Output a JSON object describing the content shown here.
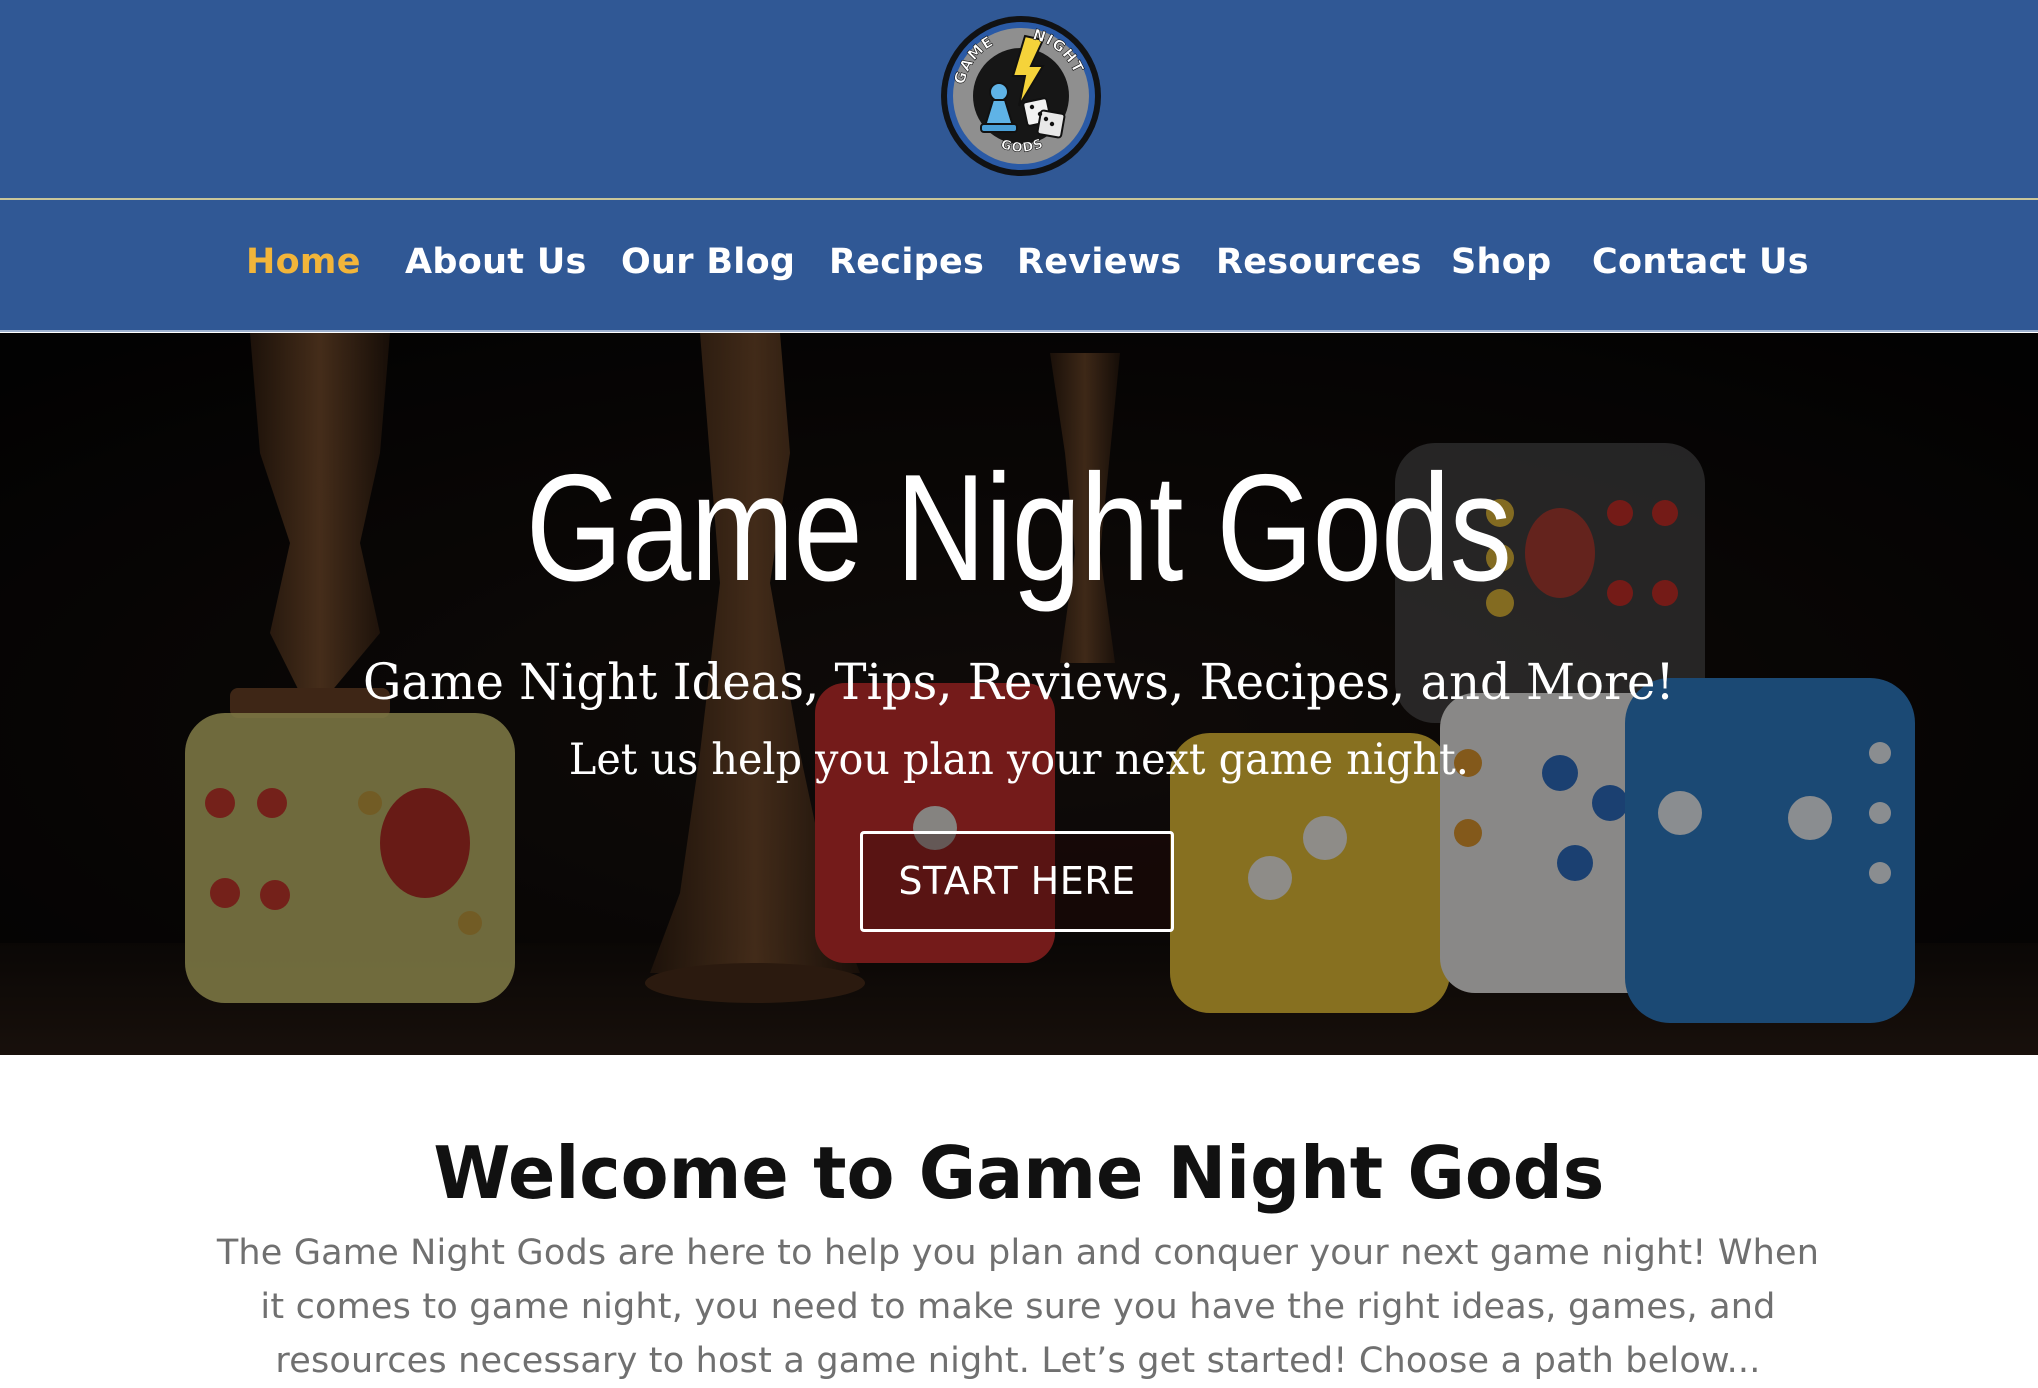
{
  "header": {
    "logo": {
      "text_top_left": "GAME",
      "text_top_right": "NIGHT",
      "text_bottom": "GODS",
      "icon": "pawn-dice-lightning-logo"
    }
  },
  "nav": {
    "items": [
      {
        "label": "Home",
        "active": true
      },
      {
        "label": "About Us",
        "active": false
      },
      {
        "label": "Our Blog",
        "active": false
      },
      {
        "label": "Recipes",
        "active": false
      },
      {
        "label": "Reviews",
        "active": false
      },
      {
        "label": "Resources",
        "active": false
      },
      {
        "label": "Shop",
        "active": false
      },
      {
        "label": "Contact Us",
        "active": false
      }
    ]
  },
  "hero": {
    "title": "Game Night Gods",
    "subtitle": "Game Night Ideas, Tips, Reviews, Recipes, and More!",
    "tagline": "Let us help you plan your next game night.",
    "button_label": "START HERE"
  },
  "welcome": {
    "title": "Welcome to Game Night Gods",
    "body": "The Game Night Gods are here to help you plan and conquer your next game night! When it comes to game night, you need to make sure you have the right ideas, games, and resources necessary to host a game night. Let’s get started! Choose a path below..."
  },
  "colors": {
    "header_bg": "#305895",
    "nav_active": "#f2b53a",
    "nav_text": "#ffffff",
    "body_text": "#707070",
    "heading_text": "#111111"
  }
}
